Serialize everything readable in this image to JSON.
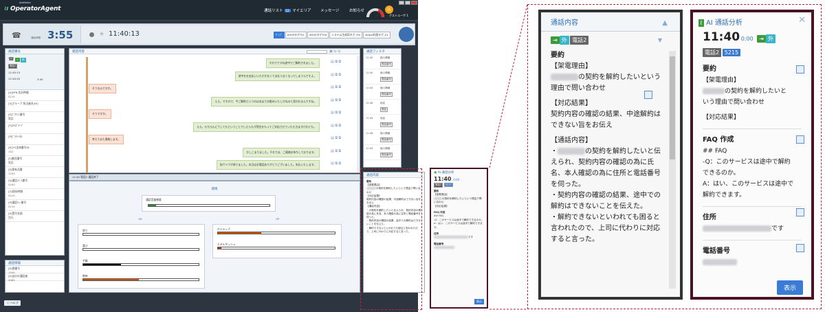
{
  "app": {
    "logo": "OperatorAgent",
    "logo_sub": "AmiVoice",
    "nav": [
      "通話リスト",
      "マイエリア",
      "メッセージ",
      "お知らせ"
    ],
    "nav_badge": "12",
    "user_name": "ゲストユーザ 1",
    "help_label": "ヘルプ"
  },
  "callbar": {
    "timer_label": "通話時間",
    "elapsed": "3:55",
    "current_time": "11:40:13",
    "tags": [
      "ｷﾞｬﾌﾞ",
      "#SVSタグT01",
      "#SVSタグT04",
      "システム生成用タグ_3%",
      "Avaya利用タグ_01"
    ]
  },
  "left_panel": {
    "title": "通話番号",
    "badges": [
      "2",
      "外"
    ],
    "name": "電話2",
    "start_time": "11:40:13",
    "end_time": "11:40:20",
    "duration": "3:55",
    "fields": [
      {
        "label": "[A]VPN 応対時間",
        "value": "5215"
      },
      {
        "label": "[S]グループ 担当者名(ID)",
        "value": ""
      },
      {
        "label": "[E]ｺﾞｻｸｲﾝ番号",
        "value": "電話"
      },
      {
        "label": "[F]ｽｷﾙｸﾞﾙｰﾌﾟ",
        "value": ""
      },
      {
        "label": "[P]ﾋﾟｸﾁｬﾝﾈﾙ",
        "value": ""
      },
      {
        "label": "[R]ｺｰﾙ全体番号ID",
        "value": "152"
      },
      {
        "label": "[F]着信番号",
        "value": "電話"
      },
      {
        "label": "[S]保有品番",
        "value": "7205"
      },
      {
        "label": "[S]通話ﾗﾍﾞﾙ番号",
        "value": "5200"
      },
      {
        "label": "[O]保存時間",
        "value": "5215"
      },
      {
        "label": "[P]通話ｷｭｰ番号",
        "value": "5215"
      },
      {
        "label": "[R]受付名前",
        "value": "西光"
      }
    ],
    "bottom_title": "通話情報",
    "bottom_fields": [
      {
        "label": "[R]保番号",
        "value": "1555"
      },
      {
        "label": "[E]自分の通話者",
        "value": "4085"
      }
    ]
  },
  "transcript": {
    "title": "発話内容",
    "messages": [
      {
        "side": "op",
        "text": "それでですね途中でご解約されました。"
      },
      {
        "side": "op",
        "text": "途中をお支払いいただかなくてはならなくなってしまうんですよ。"
      },
      {
        "side": "cu",
        "text": "そうなんですか。"
      },
      {
        "side": "op",
        "text": "ええ。ですので、今ご解約というのはあまりお勧めいたしかねると思われるんですね。"
      },
      {
        "side": "cu",
        "text": "そうですか。"
      },
      {
        "side": "op",
        "text": "ええ。もちろんどうしてもということでしたらもが責任をもってご対応させていただきますけれども。"
      },
      {
        "side": "cu",
        "text": "考えてまた連絡します。"
      },
      {
        "side": "op",
        "text": "かしこまりました。それでは、ご連絡お待ちしております。"
      },
      {
        "side": "op",
        "text": "私サトウが承りました。本日はお電話ありがとうございました。失礼いたします。"
      }
    ],
    "status_bar": "11:40  電話2  通話終了"
  },
  "emotion": {
    "title": "感情",
    "call_level_label": "通話音量感度",
    "ok_label": "OK",
    "op_label": "OP",
    "left_bars": [
      {
        "label": "怒り",
        "value": 0.0,
        "color": "#c0392b"
      },
      {
        "label": "喜び",
        "value": 0.0,
        "color": "#c0392b"
      },
      {
        "label": "平静",
        "value": 0.33,
        "color": "#111111"
      },
      {
        "label": "期待",
        "value": 0.48,
        "color": "#d35400"
      }
    ],
    "right_bars": [
      {
        "label": "ポジティブ",
        "value": 0.37,
        "color": "#d35400"
      },
      {
        "label": "エネルギッシュ",
        "value": 0.03,
        "color": "#c0392b"
      }
    ],
    "call_level": 0.06
  },
  "filter": {
    "title": "通話フィルタ",
    "items": [
      {
        "time": "11:40",
        "name": "個人情報",
        "badge": "電話番号"
      },
      {
        "time": "11:40",
        "name": "個人情報",
        "badge": "電話番号"
      },
      {
        "time": "11:45",
        "name": "個人情報",
        "badge": "電話番号"
      },
      {
        "time": "11:46",
        "name": "地名",
        "badge": "電話"
      },
      {
        "time": "11:45",
        "name": "地名",
        "badge": "電話番号"
      },
      {
        "time": "11:46",
        "name": "個人情報",
        "badge": "電話番号"
      },
      {
        "time": "11:45",
        "name": "個人情報",
        "badge": "電話番号"
      }
    ]
  },
  "small_summary": {
    "title": "通話内容",
    "req_title": "要約",
    "lines": [
      "【架電理由】",
      "の契約を解約したいという理由で問い合わせ",
      "【対応結果】",
      "契約内容の確認の結果、中途解約はできない旨をお伝え",
      "【通話内容】",
      "・の契約を解約したいと伝えられ、契約内容の確認の為に氏名、本人確認の為に住所と電話番号を伺った。",
      "・契約内容の確認の結果、途中での解約はできないことを伝えた。",
      "・解約できないといわれても困ると言われたので、上司に代わりに対応すると言った。"
    ]
  },
  "ai_small": {
    "title": "AI 通話分析",
    "time": "11:40",
    "sub": "0:00",
    "badges": [
      "電話2",
      "5215"
    ],
    "summary_title": "要約",
    "summary": [
      "【架電理由】",
      "の契約を解約したいという理由で問い合わせ",
      "【対応結果】"
    ],
    "faq_title": "FAQ 作成",
    "faq": [
      "## FAQ",
      "-Q：このサービスは途中で解約できるのか。",
      "A：はい、このサービスは途中で解約できます。"
    ],
    "addr_title": "住所",
    "addr_suffix": "です",
    "phone_title": "電話番号",
    "show": "表示"
  },
  "big_summary": {
    "title": "通話内容",
    "badges": [
      "外",
      "電話2"
    ],
    "req_title": "要約",
    "reason_head": "【架電理由】",
    "reason": "の契約を解約したいという理由で問い合わせ",
    "result_head": "【対応結果】",
    "result": "契約内容の確認の結果、中途解約はできない旨をお伝え",
    "content_head": "【通話内容】",
    "content1": "の契約を解約したいと伝えられ、契約内容の確認の為に氏名、本人確認の為に住所と電話番号を伺った。",
    "content2": "・契約内容の確認の結果、途中での解約はできないことを伝えた。",
    "content3": "・解約できないといわれても困ると言われたので、上司に代わりに対応すると言った。"
  },
  "big_ai": {
    "title": "AI 通話分析",
    "time": "11:40",
    "sub": "0:00",
    "badges": [
      "電話2",
      "5215"
    ],
    "summary_title": "要約",
    "reason_head": "【架電理由】",
    "reason": "の契約を解約したいという理由で問い合わせ",
    "result_head": "【対応結果】",
    "faq_title": "FAQ 作成",
    "faq1": "## FAQ",
    "faq2": "-Q：このサービスは途中で解約できるのか。",
    "faq3": "A：はい、このサービスは途中で解約できます。",
    "addr_title": "住所",
    "addr_suffix": "です",
    "phone_title": "電話番号",
    "show": "表示"
  },
  "colors": {
    "accent": "#3a7bd5",
    "dash": "#c0223a",
    "dark_frame": "#2a2a2a",
    "ai_frame": "#4a1324"
  }
}
